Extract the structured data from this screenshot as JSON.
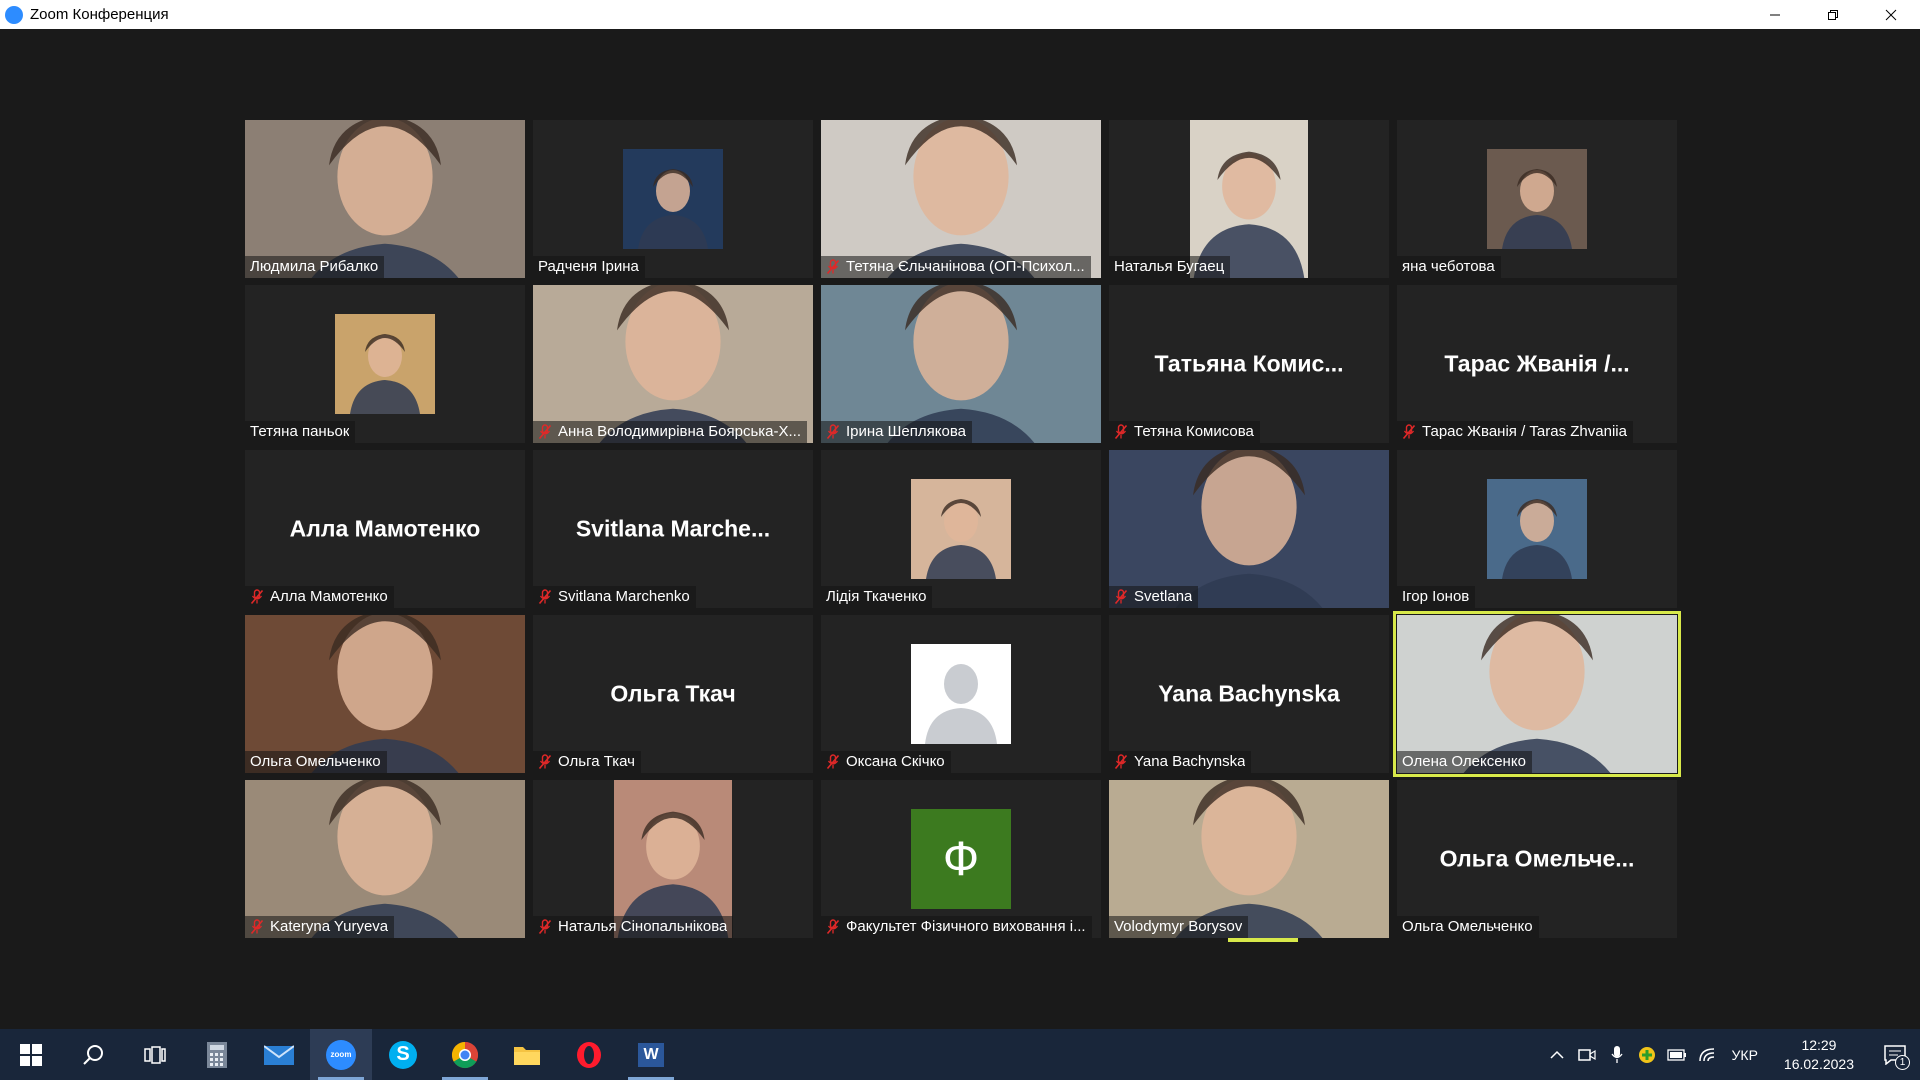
{
  "window": {
    "title": "Zoom Конференция"
  },
  "tiles": [
    {
      "name": "Людмила Рибалко",
      "muted": false,
      "type": "video",
      "bg": "#8c7f74"
    },
    {
      "name": "Радченя Ірина",
      "muted": false,
      "type": "photo",
      "bg": "#233a5c"
    },
    {
      "name": "Тетяна Єльчанінова (ОП-Психол...",
      "muted": true,
      "type": "video",
      "bg": "#cfcac4"
    },
    {
      "name": "Наталья Бугаец",
      "muted": false,
      "type": "photo-wide",
      "bg": "#d9d2c6"
    },
    {
      "name": "яна чеботова",
      "muted": false,
      "type": "photo",
      "bg": "#6b5a4f"
    },
    {
      "name": "Тетяна паньок",
      "muted": false,
      "type": "photo",
      "bg": "#c9a36b"
    },
    {
      "name": "Анна Володимирівна Боярська-Х...",
      "muted": true,
      "type": "video",
      "bg": "#b8aa98"
    },
    {
      "name": "Ірина Шеплякова",
      "muted": true,
      "type": "video",
      "bg": "#6f8795"
    },
    {
      "name": "Тетяна Комисова",
      "muted": true,
      "type": "text",
      "display": "Татьяна  Комис..."
    },
    {
      "name": "Тарас Жванія / Taras Zhvaniia",
      "muted": true,
      "type": "text",
      "display": "Тарас  Жванія  /..."
    },
    {
      "name": "Алла Мамотенко",
      "muted": true,
      "type": "text",
      "display": "Алла Мамотенко"
    },
    {
      "name": "Svitlana Marchenko",
      "muted": true,
      "type": "text",
      "display": "Svitlana  Marche..."
    },
    {
      "name": "Лідія Ткаченко",
      "muted": false,
      "type": "photo",
      "bg": "#d6b59b"
    },
    {
      "name": "Svetlana",
      "muted": true,
      "type": "video",
      "bg": "#3a4660"
    },
    {
      "name": "Ігор Іонов",
      "muted": false,
      "type": "photo",
      "bg": "#4a6a8a"
    },
    {
      "name": "Ольга Омельченко",
      "muted": false,
      "type": "video",
      "bg": "#6e4a36"
    },
    {
      "name": "Ольга Ткач",
      "muted": true,
      "type": "text",
      "display": "Ольга Ткач"
    },
    {
      "name": "Оксана Скічко",
      "muted": true,
      "type": "placeholder"
    },
    {
      "name": "Yana Bachynska",
      "muted": true,
      "type": "text",
      "display": "Yana Bachynska"
    },
    {
      "name": "Олена Олексенко",
      "muted": false,
      "type": "video",
      "bg": "#cfd2d0",
      "active": true
    },
    {
      "name": "Kateryna Yuryeva",
      "muted": true,
      "type": "video",
      "bg": "#9a8a78"
    },
    {
      "name": "Наталья Сінопальнікова",
      "muted": true,
      "type": "photo-wide",
      "bg": "#b98a78"
    },
    {
      "name": "Факультет Фізичного виховання і...",
      "muted": true,
      "type": "letter",
      "letter": "Ф",
      "bg": "#3c7a1f"
    },
    {
      "name": "Volodymyr Borysov",
      "muted": false,
      "type": "video",
      "bg": "#b9ab92"
    },
    {
      "name": "Ольга Омельченко",
      "muted": false,
      "type": "text",
      "display": "Ольга  Омельче..."
    }
  ],
  "taskbar": {
    "zoom_icon_label": "zoom",
    "skype_letter": "S",
    "word_letter": "W",
    "language": "УКР",
    "time": "12:29",
    "date": "16.02.2023",
    "notifications": "1"
  },
  "colors": {
    "active_speaker": "#d8e94a",
    "mute_red": "#e02828",
    "taskbar_bg": "#19263a"
  }
}
